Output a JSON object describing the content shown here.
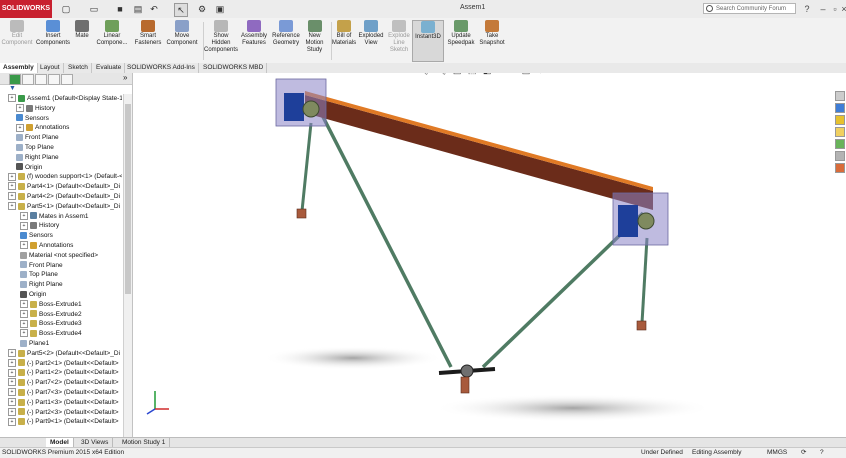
{
  "app": {
    "logo_text": "SOLIDWORKS",
    "document_title": "Assem1",
    "search_placeholder": "Search Community Forum"
  },
  "ribbon": {
    "buttons": [
      {
        "label": "Edit\nComponent"
      },
      {
        "label": "Insert\nComponents"
      },
      {
        "label": "Mate"
      },
      {
        "label": "Linear\nCompone..."
      },
      {
        "label": "Smart\nFasteners"
      },
      {
        "label": "Move\nComponent"
      },
      {
        "label": "Show\nHidden\nComponents"
      },
      {
        "label": "Assembly\nFeatures"
      },
      {
        "label": "Reference\nGeometry"
      },
      {
        "label": "New\nMotion\nStudy"
      },
      {
        "label": "Bill of\nMaterials"
      },
      {
        "label": "Exploded\nView"
      },
      {
        "label": "Explode\nLine\nSketch"
      },
      {
        "label": "Instant3D"
      },
      {
        "label": "Update\nSpeedpak"
      },
      {
        "label": "Take\nSnapshot"
      }
    ]
  },
  "cm_tabs": [
    "Assembly",
    "Layout",
    "Sketch",
    "Evaluate",
    "SOLIDWORKS Add-Ins",
    "SOLIDWORKS MBD"
  ],
  "tree": [
    {
      "label": "Assem1  (Default<Display State-1>)"
    },
    {
      "label": "History"
    },
    {
      "label": "Sensors"
    },
    {
      "label": "Annotations"
    },
    {
      "label": "Front Plane"
    },
    {
      "label": "Top Plane"
    },
    {
      "label": "Right Plane"
    },
    {
      "label": "Origin"
    },
    {
      "label": "(f) wooden support<1> (Default-<"
    },
    {
      "label": "Part4<1> (Default<<Default>_Di"
    },
    {
      "label": "Part4<2> (Default<<Default>_Di"
    },
    {
      "label": "Part5<1> (Default<<Default>_Di"
    },
    {
      "label": "Mates in Assem1"
    },
    {
      "label": "History"
    },
    {
      "label": "Sensors"
    },
    {
      "label": "Annotations"
    },
    {
      "label": "Material <not specified>"
    },
    {
      "label": "Front Plane"
    },
    {
      "label": "Top Plane"
    },
    {
      "label": "Right Plane"
    },
    {
      "label": "Origin"
    },
    {
      "label": "Boss-Extrude1"
    },
    {
      "label": "Boss-Extrude2"
    },
    {
      "label": "Boss-Extrude3"
    },
    {
      "label": "Boss-Extrude4"
    },
    {
      "label": "Plane1"
    },
    {
      "label": "Part5<2> (Default<<Default>_Di"
    },
    {
      "label": "(-) Part2<1> (Default<<Default>"
    },
    {
      "label": "(-) Part1<2> (Default<<Default>"
    },
    {
      "label": "(-) Part7<2> (Default<<Default>"
    },
    {
      "label": "(-) Part7<3> (Default<<Default>"
    },
    {
      "label": "(-) Part1<3> (Default<<Default>"
    },
    {
      "label": "(-) Part2<3> (Default<<Default>"
    },
    {
      "label": "(-) Part9<1> (Default<<Default>"
    }
  ],
  "bottom_tabs": [
    "Model",
    "3D Views",
    "Motion Study 1"
  ],
  "status": {
    "edition": "SOLIDWORKS Premium 2015 x64 Edition",
    "state": "Under Defined",
    "mode": "Editing Assembly",
    "units": "MMGS"
  },
  "colors": {
    "accent": "#c8202f",
    "beam": "#6b2c1a",
    "beam_edge": "#e07a25",
    "rod": "#4f7b63",
    "box": "#8a83c7",
    "foot": "#a85a3c"
  }
}
